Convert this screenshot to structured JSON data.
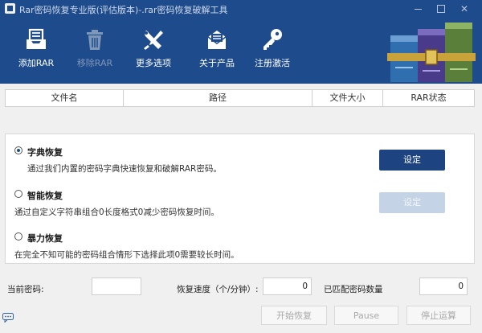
{
  "window": {
    "title": "Rar密码恢复专业版(评估版本)-.rar密码恢复破解工具"
  },
  "toolbar": {
    "items": [
      {
        "label": "添加RAR",
        "icon": "inbox-tray-icon",
        "enabled": true
      },
      {
        "label": "移除RAR",
        "icon": "trash-can-icon",
        "enabled": false
      },
      {
        "label": "更多选项",
        "icon": "wrench-screwdriver-icon",
        "enabled": true
      },
      {
        "label": "关于产品",
        "icon": "envelope-icon",
        "enabled": true
      },
      {
        "label": "注册激活",
        "icon": "key-icon",
        "enabled": true
      }
    ]
  },
  "file_table": {
    "columns": [
      "文件名",
      "路径",
      "文件大小",
      "RAR状态"
    ],
    "rows": []
  },
  "recovery": {
    "options": [
      {
        "title": "字典恢复",
        "description": "通过我们内置的密码字典快速恢复和破解RAR密码。",
        "selected": true
      },
      {
        "title": "智能恢复",
        "description": "通过自定义字符串组合0长度格式0减少密码恢复时间。",
        "selected": false
      },
      {
        "title": "暴力恢复",
        "description": "在完全不知可能的密码组合情形下选择此项0需要较长时间。",
        "selected": false
      }
    ],
    "settings_label": "设定",
    "settings_label_2": "设定"
  },
  "status": {
    "current_password_label": "当前密码:",
    "current_password_value": "",
    "speed_label": "恢复速度（个/分钟）:",
    "speed_value": "0",
    "matched_label": "已匹配密码数量",
    "matched_value": "0"
  },
  "actions": {
    "start": "开始恢复",
    "pause": "Pause",
    "stop": "停止运算"
  },
  "colors": {
    "header_bg": "#1e4b8c",
    "primary_button": "#1d4380",
    "disabled_button": "#c5d3e6"
  }
}
